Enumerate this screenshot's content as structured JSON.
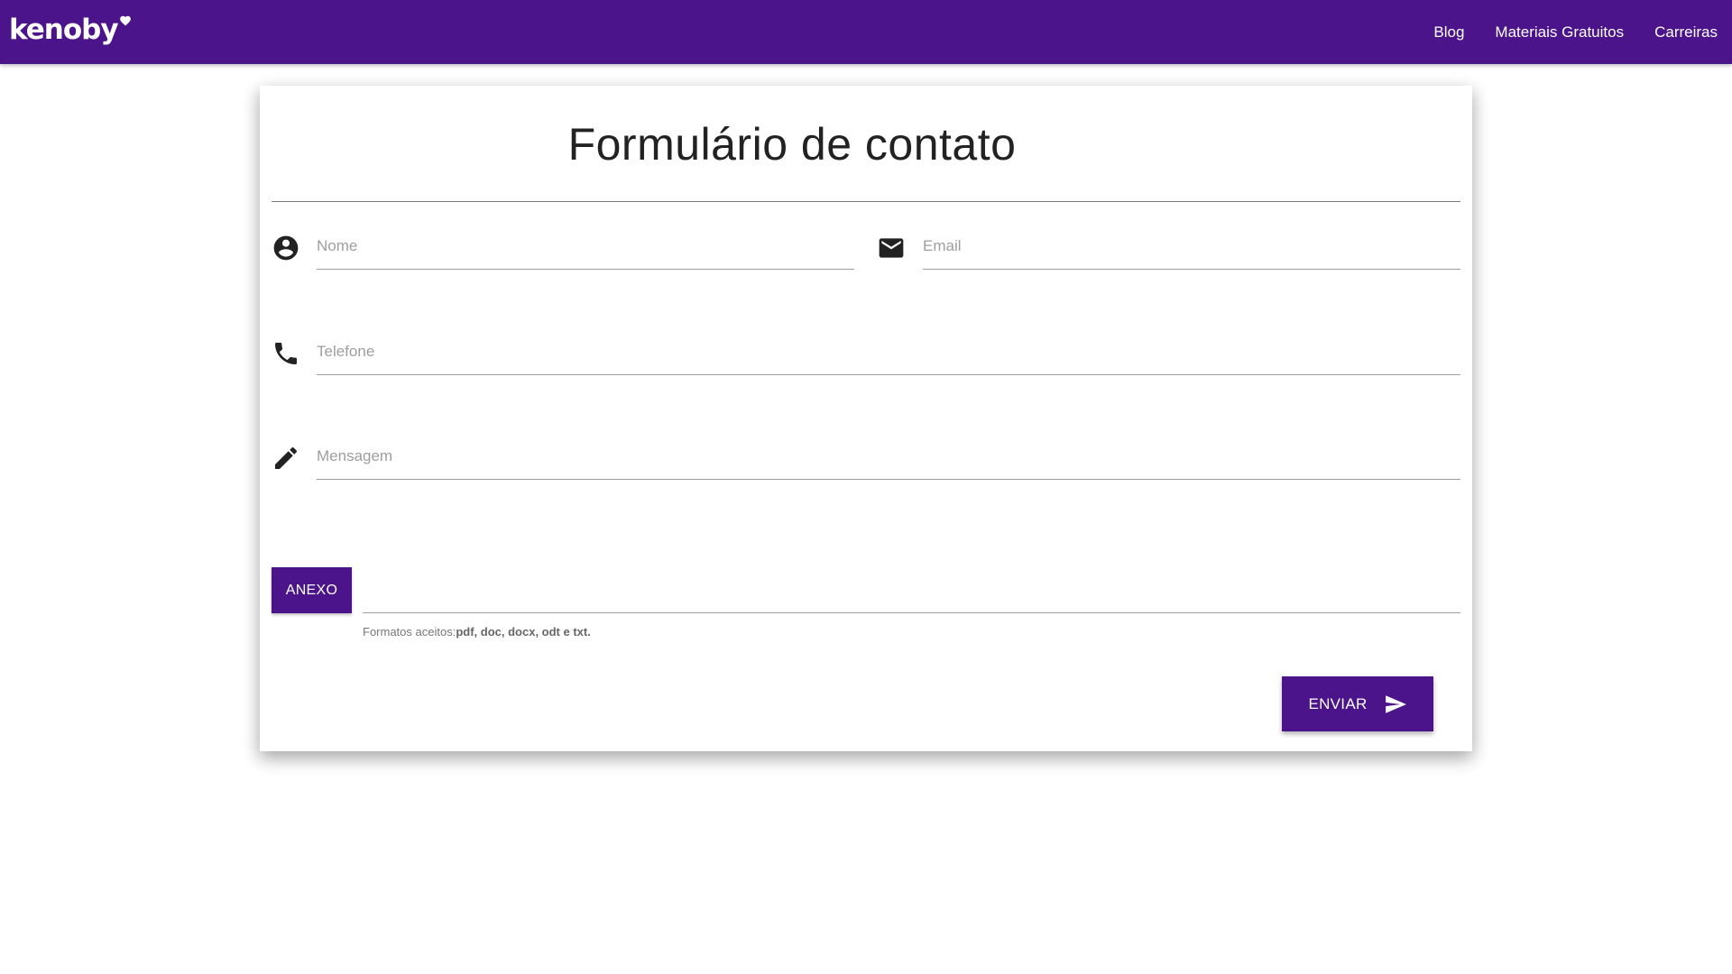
{
  "navbar": {
    "brand": "kenoby",
    "links": [
      "Blog",
      "Materiais Gratuitos",
      "Carreiras"
    ]
  },
  "form": {
    "title": "Formulário de contato",
    "fields": {
      "nome": {
        "placeholder": "Nome",
        "value": "",
        "icon": "account-circle-icon"
      },
      "email": {
        "placeholder": "Email",
        "value": "",
        "icon": "email-icon"
      },
      "telefone": {
        "placeholder": "Telefone",
        "value": "",
        "icon": "phone-icon"
      },
      "mensagem": {
        "placeholder": "Mensagem",
        "value": "",
        "icon": "pencil-icon"
      }
    },
    "attach_label": "ANEXO",
    "formats_prefix": "Formatos aceitos:",
    "formats_list": "pdf, doc, docx, odt e txt.",
    "submit_label": "ENVIAR",
    "submit_icon": "send-icon"
  },
  "colors": {
    "brand_purple": "#4b148a",
    "text_dark": "#222222",
    "placeholder": "#9e9e9e"
  }
}
